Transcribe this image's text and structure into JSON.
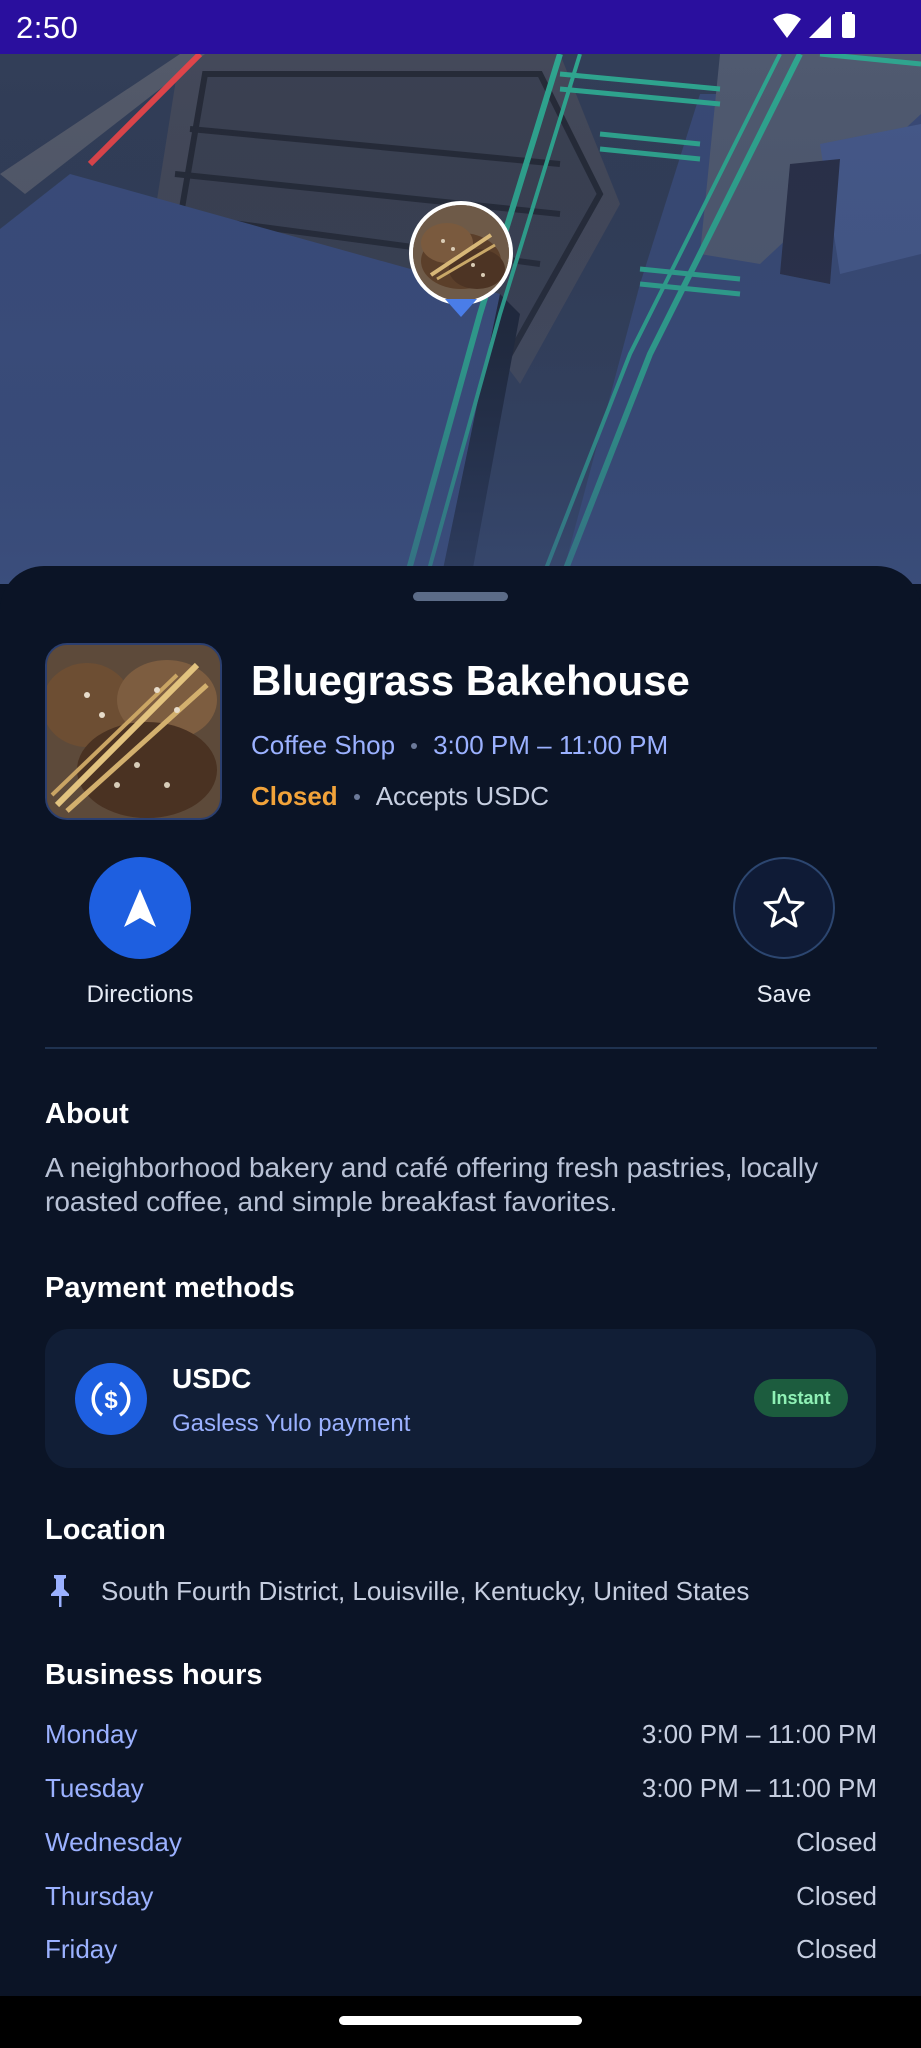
{
  "status_bar": {
    "time": "2:50"
  },
  "place": {
    "name": "Bluegrass Bakehouse",
    "category": "Coffee Shop",
    "hours_today": "3:00 PM – 11:00 PM",
    "status": "Closed",
    "accepts": "Accepts USDC"
  },
  "actions": {
    "directions_label": "Directions",
    "save_label": "Save"
  },
  "about": {
    "title": "About",
    "text": "A neighborhood bakery and café offering fresh pastries, locally roasted coffee, and simple breakfast favorites."
  },
  "payment": {
    "title": "Payment methods",
    "method_name": "USDC",
    "method_sub": "Gasless Yulo payment",
    "badge": "Instant"
  },
  "location": {
    "title": "Location",
    "address": "South Fourth District, Louisville, Kentucky, United States"
  },
  "hours": {
    "title": "Business hours",
    "rows": [
      {
        "day": "Monday",
        "time": "3:00 PM – 11:00 PM"
      },
      {
        "day": "Tuesday",
        "time": "3:00 PM – 11:00 PM"
      },
      {
        "day": "Wednesday",
        "time": "Closed"
      },
      {
        "day": "Thursday",
        "time": "Closed"
      },
      {
        "day": "Friday",
        "time": "Closed"
      }
    ]
  },
  "colors": {
    "status_bar": "#2a0f9e",
    "accent": "#1e5fe0",
    "closed": "#f2a33a",
    "link": "#9bb1ff",
    "sheet_bg": "#0b1426",
    "badge_bg": "#1c5c3e"
  },
  "icons": {
    "wifi": "wifi-icon",
    "signal": "cell-signal-icon",
    "battery": "battery-icon",
    "directions": "navigation-arrow-icon",
    "save": "star-outline-icon",
    "usdc": "usdc-dollar-icon",
    "location": "push-pin-icon"
  }
}
